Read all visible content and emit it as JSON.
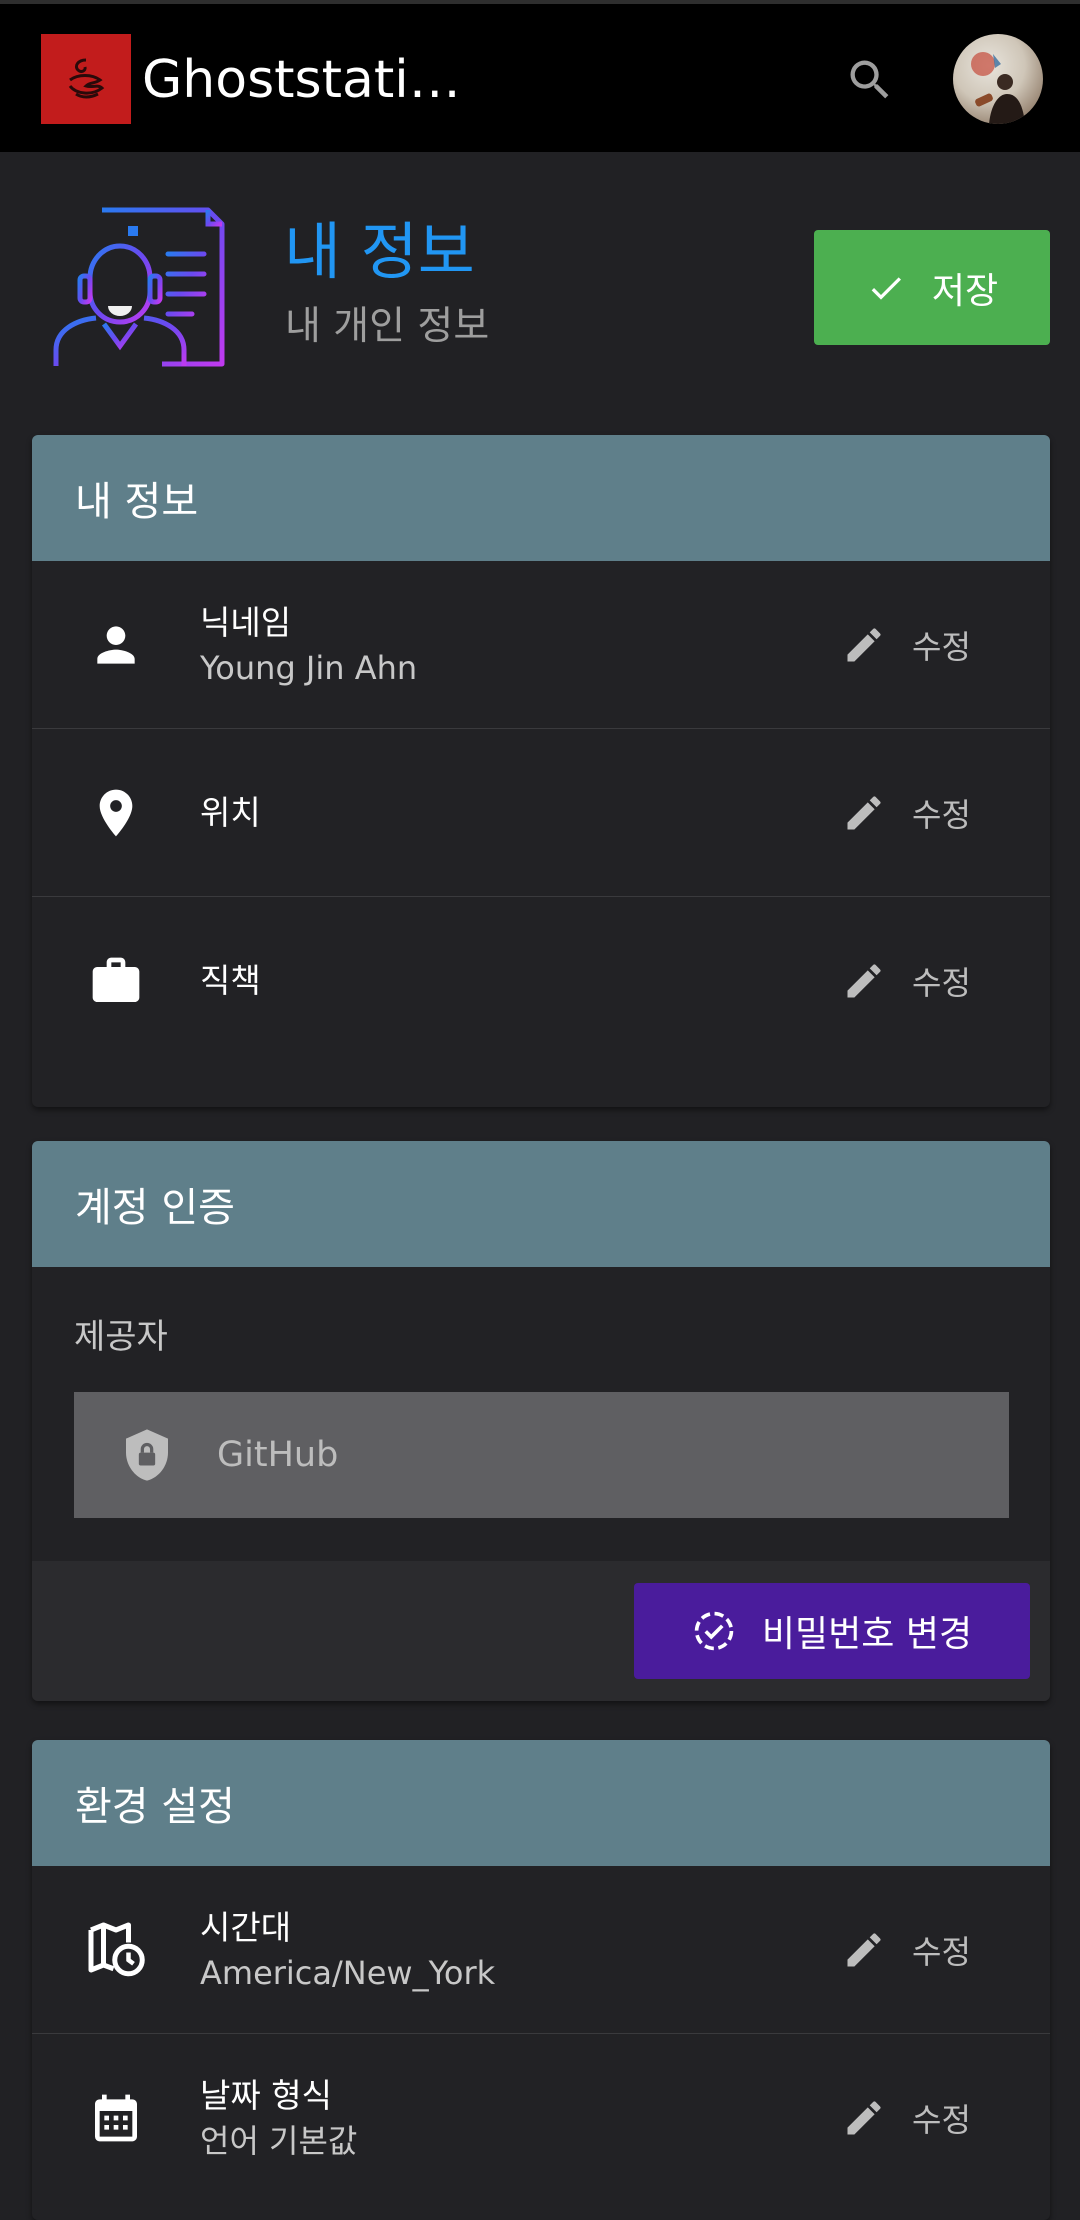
{
  "app": {
    "title": "Ghoststati…"
  },
  "header": {
    "title": "내 정보",
    "subtitle": "내 개인 정보",
    "save_label": "저장"
  },
  "profile_card": {
    "title": "내 정보",
    "edit_label": "수정",
    "rows": [
      {
        "icon": "person-icon",
        "label": "닉네임",
        "value": "Young Jin Ahn"
      },
      {
        "icon": "location-pin-icon",
        "label": "위치",
        "value": ""
      },
      {
        "icon": "briefcase-icon",
        "label": "직책",
        "value": ""
      }
    ]
  },
  "auth_card": {
    "title": "계정 인증",
    "provider_label": "제공자",
    "provider_value": "GitHub",
    "change_password_label": "비밀번호 변경"
  },
  "settings_card": {
    "title": "환경 설정",
    "edit_label": "수정",
    "rows": [
      {
        "icon": "map-clock-icon",
        "label": "시간대",
        "value": "America/New_York"
      },
      {
        "icon": "calendar-icon",
        "label": "날짜 형식",
        "value": "언어 기본값"
      }
    ]
  },
  "colors": {
    "topbar": "#000000",
    "background": "#212124",
    "card_header": "#5f7f8a",
    "title_accent": "#2196f3",
    "save_button": "#4caf50",
    "password_button": "#4a1c9c",
    "logo_bg": "#c21c1c"
  }
}
